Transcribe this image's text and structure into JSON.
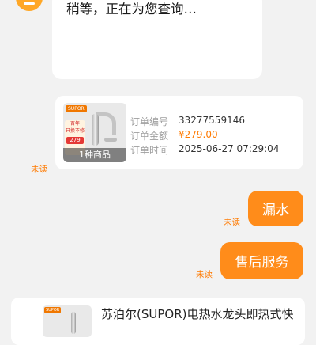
{
  "chat": {
    "agent_message": "稍等，正在为您查询…",
    "order_card": {
      "count_label": "1种商品",
      "brand_label": "SUPOR",
      "promo_line1": "百年",
      "promo_line2": "只换不修",
      "promo_price": "279",
      "fields": [
        {
          "label": "订单编号",
          "value": "33277559146"
        },
        {
          "label": "订单金额",
          "value": "¥279.00"
        },
        {
          "label": "订单时间",
          "value": "2025-06-27 07:29:04"
        }
      ],
      "status": "未读"
    },
    "outgoing": [
      {
        "text": "漏水",
        "status": "未读"
      },
      {
        "text": "售后服务",
        "status": "未读"
      }
    ],
    "product_card": {
      "brand_label": "SUPOR",
      "title": "苏泊尔(SUPOR)电热水龙头即热式快"
    }
  },
  "colors": {
    "accent": "#ff8c1a",
    "price": "#ff7a00",
    "background": "#f2f2f2"
  }
}
